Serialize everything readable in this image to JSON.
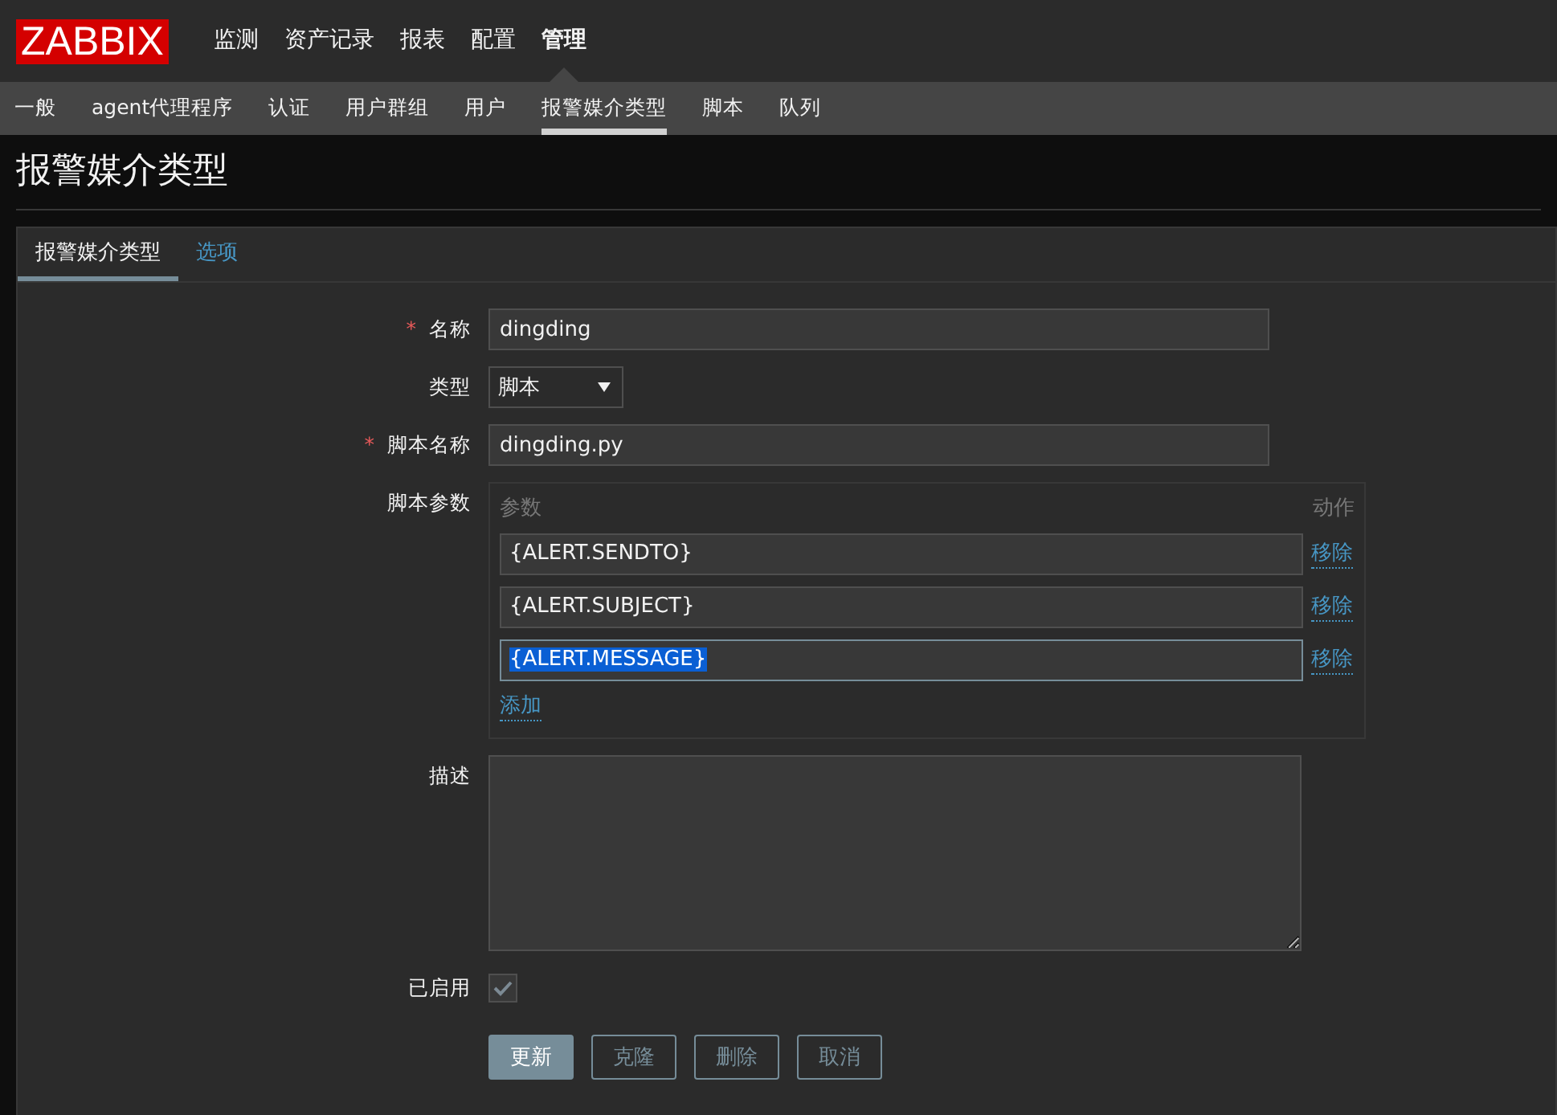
{
  "logo": "ZABBIX",
  "main_menu": [
    {
      "label": "监测",
      "selected": false
    },
    {
      "label": "资产记录",
      "selected": false
    },
    {
      "label": "报表",
      "selected": false
    },
    {
      "label": "配置",
      "selected": false
    },
    {
      "label": "管理",
      "selected": true
    }
  ],
  "sub_menu": [
    {
      "label": "一般",
      "selected": false
    },
    {
      "label": "agent代理程序",
      "selected": false
    },
    {
      "label": "认证",
      "selected": false
    },
    {
      "label": "用户群组",
      "selected": false
    },
    {
      "label": "用户",
      "selected": false
    },
    {
      "label": "报警媒介类型",
      "selected": true
    },
    {
      "label": "脚本",
      "selected": false
    },
    {
      "label": "队列",
      "selected": false
    }
  ],
  "page_title": "报警媒介类型",
  "form_tabs": [
    {
      "label": "报警媒介类型",
      "selected": true
    },
    {
      "label": "选项",
      "selected": false
    }
  ],
  "fields": [
    {
      "kind": "text",
      "label": "名称",
      "required_mark": "*",
      "value": "dingding"
    },
    {
      "kind": "select",
      "label": "类型",
      "value": "脚本"
    },
    {
      "kind": "text",
      "label": "脚本名称",
      "required_mark": "*",
      "value": "dingding.py"
    }
  ],
  "script_params": {
    "label": "脚本参数",
    "header_param": "参数",
    "header_action": "动作",
    "rows": [
      {
        "value": "{ALERT.SENDTO}",
        "focused": false,
        "remove": "移除"
      },
      {
        "value": "{ALERT.SUBJECT}",
        "focused": false,
        "remove": "移除"
      },
      {
        "value": "{ALERT.MESSAGE}",
        "focused": true,
        "remove": "移除"
      }
    ],
    "add": "添加"
  },
  "description": {
    "label": "描述"
  },
  "enabled": {
    "label": "已启用",
    "checked": true
  },
  "buttons": [
    {
      "label": "更新",
      "kind": "primary"
    },
    {
      "label": "克隆",
      "kind": "secondary"
    },
    {
      "label": "删除",
      "kind": "secondary"
    },
    {
      "label": "取消",
      "kind": "secondary"
    }
  ]
}
